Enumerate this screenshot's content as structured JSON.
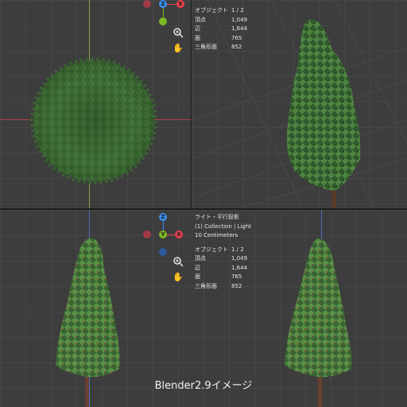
{
  "colors": {
    "x_axis": "#e8404f",
    "y_axis": "#7db823",
    "z_axis": "#3a8ff0",
    "foliage": "#3f6b35",
    "trunk": "#5a3a28"
  },
  "gizmo_top": {
    "z": "Z",
    "x": "X"
  },
  "gizmo_bottom": {
    "z": "Z",
    "y": "Y",
    "x": "X"
  },
  "stats_top": {
    "rows": [
      {
        "label": "オブジェクト",
        "value": "1 / 2"
      },
      {
        "label": "頂点",
        "value": "1,049"
      },
      {
        "label": "辺",
        "value": "1,644"
      },
      {
        "label": "面",
        "value": "765"
      },
      {
        "label": "三角形面",
        "value": "852"
      }
    ]
  },
  "stats_bottom": {
    "header_line1": "ライト・平行投影",
    "header_line2": "(1) Collection | Light",
    "header_line3": "10 Centimeters",
    "rows": [
      {
        "label": "オブジェクト",
        "value": "1 / 2"
      },
      {
        "label": "頂点",
        "value": "1,049"
      },
      {
        "label": "辺",
        "value": "1,644"
      },
      {
        "label": "面",
        "value": "765"
      },
      {
        "label": "三角形面",
        "value": "852"
      }
    ]
  },
  "icons": {
    "zoom": "zoom-icon",
    "pan": "hand-pan-icon"
  },
  "caption": "Blender2.9イメージ"
}
